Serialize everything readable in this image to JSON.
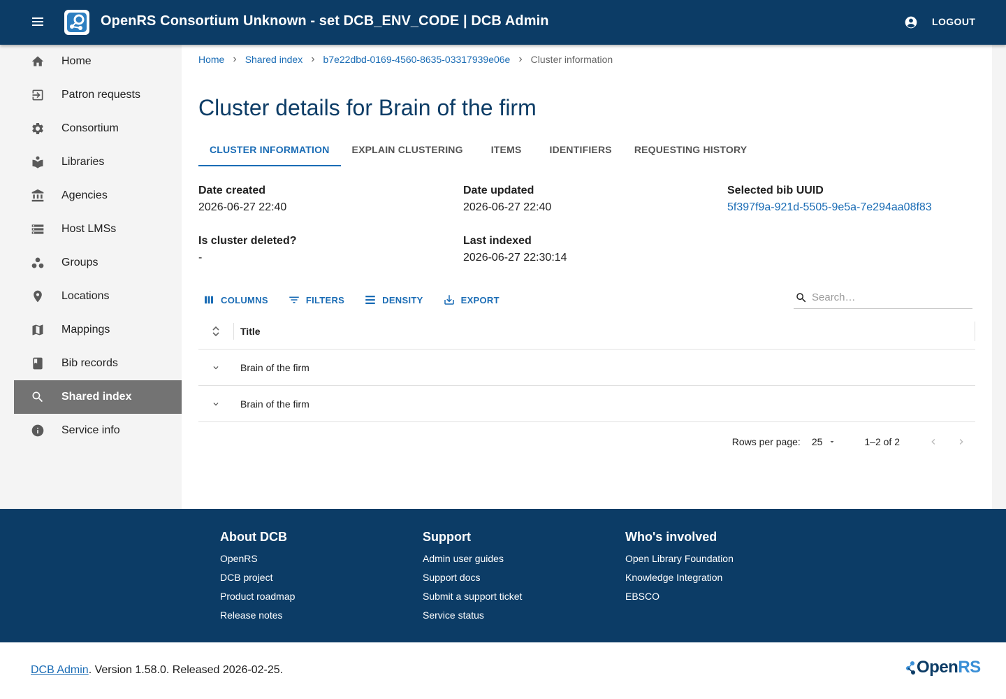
{
  "header": {
    "title": "OpenRS Consortium Unknown - set DCB_ENV_CODE | DCB Admin",
    "logout": "LOGOUT"
  },
  "sidebar": {
    "items": [
      {
        "label": "Home",
        "icon": "home-icon"
      },
      {
        "label": "Patron requests",
        "icon": "exit-to-app-icon"
      },
      {
        "label": "Consortium",
        "icon": "gear-icon"
      },
      {
        "label": "Libraries",
        "icon": "book-reader-icon"
      },
      {
        "label": "Agencies",
        "icon": "bank-icon"
      },
      {
        "label": "Host LMSs",
        "icon": "storage-icon"
      },
      {
        "label": "Groups",
        "icon": "workspaces-icon"
      },
      {
        "label": "Locations",
        "icon": "location-pin-icon"
      },
      {
        "label": "Mappings",
        "icon": "map-icon"
      },
      {
        "label": "Bib records",
        "icon": "book-icon"
      },
      {
        "label": "Shared index",
        "icon": "search-icon",
        "active": true
      },
      {
        "label": "Service info",
        "icon": "info-icon"
      }
    ]
  },
  "breadcrumbs": {
    "home": "Home",
    "shared_index": "Shared index",
    "cluster_id": "b7e22dbd-0169-4560-8635-03317939e06e",
    "current": "Cluster information"
  },
  "page_title": "Cluster details for Brain of the firm",
  "tabs": [
    "CLUSTER INFORMATION",
    "EXPLAIN CLUSTERING",
    "ITEMS",
    "IDENTIFIERS",
    "REQUESTING HISTORY"
  ],
  "details": {
    "date_created_label": "Date created",
    "date_created": "2026-06-27 22:40",
    "date_updated_label": "Date updated",
    "date_updated": "2026-06-27 22:40",
    "selected_bib_label": "Selected bib UUID",
    "selected_bib": "5f397f9a-921d-5505-9e5a-7e294aa08f83",
    "deleted_label": "Is cluster deleted?",
    "deleted": "-",
    "last_indexed_label": "Last indexed",
    "last_indexed": "2026-06-27 22:30:14"
  },
  "toolbar": {
    "columns": "COLUMNS",
    "filters": "FILTERS",
    "density": "DENSITY",
    "export": "EXPORT",
    "search_placeholder": "Search…"
  },
  "grid": {
    "column_title": "Title",
    "rows": [
      {
        "title": "Brain of the firm"
      },
      {
        "title": "Brain of the firm"
      }
    ]
  },
  "pager": {
    "rows_per_page_label": "Rows per page:",
    "rows_per_page": "25",
    "range": "1–2 of 2"
  },
  "footer": {
    "about": {
      "heading": "About DCB",
      "links": [
        "OpenRS",
        "DCB project",
        "Product roadmap",
        "Release notes"
      ]
    },
    "support": {
      "heading": "Support",
      "links": [
        "Admin user guides",
        "Support docs",
        "Submit a support ticket",
        "Service status"
      ]
    },
    "involved": {
      "heading": "Who's involved",
      "links": [
        "Open Library Foundation",
        "Knowledge Integration",
        "EBSCO"
      ]
    }
  },
  "bottom": {
    "app_link": "DCB Admin",
    "version_text": ". Version 1.58.0. Released 2026-02-25.",
    "logo_prefix": "Open",
    "logo_suffix": "RS"
  },
  "colors": {
    "brand": "#0c3c66",
    "link": "#1a6cb5",
    "active_nav": "#737373"
  }
}
